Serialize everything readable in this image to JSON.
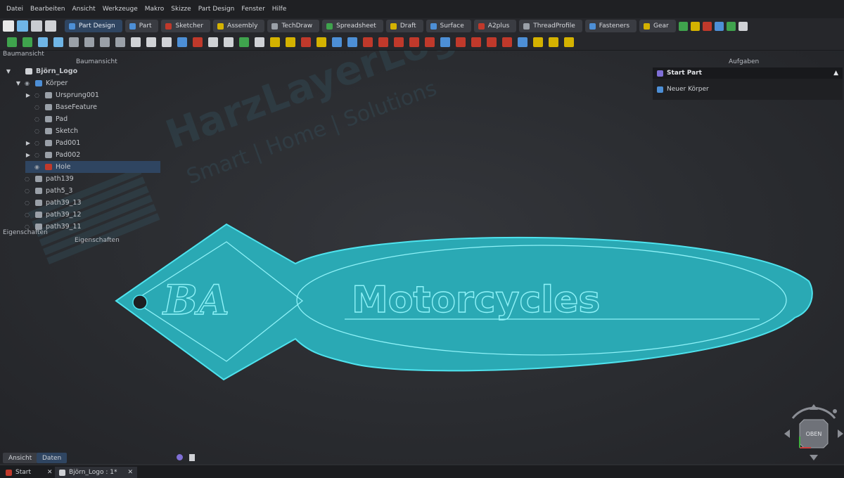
{
  "menu": [
    "Datei",
    "Bearbeiten",
    "Ansicht",
    "Werkzeuge",
    "Makro",
    "Skizze",
    "Part Design",
    "Fenster",
    "Hilfe"
  ],
  "workbenches": [
    {
      "label": "Part Design",
      "color": "#4d8fd6",
      "active": true
    },
    {
      "label": "Part",
      "color": "#4d8fd6"
    },
    {
      "label": "Sketcher",
      "color": "#c0392b"
    },
    {
      "label": "Assembly",
      "color": "#d4b200"
    },
    {
      "label": "TechDraw",
      "color": "#9aa0a8"
    },
    {
      "label": "Spreadsheet",
      "color": "#3fa34d"
    },
    {
      "label": "Draft",
      "color": "#d4b200"
    },
    {
      "label": "Surface",
      "color": "#4d8fd6"
    },
    {
      "label": "A2plus",
      "color": "#c0392b"
    },
    {
      "label": "ThreadProfile",
      "color": "#9aa0a8"
    },
    {
      "label": "Fasteners",
      "color": "#4d8fd6"
    },
    {
      "label": "Gear",
      "color": "#d4b200"
    }
  ],
  "panels": {
    "tree_header_left": "Baumansicht",
    "tree_header": "Baumansicht",
    "props_header_left": "Eigenschaften",
    "props_header": "Eigenschaften",
    "tasks_header": "Aufgaben"
  },
  "tree": [
    {
      "label": "Björn_Logo",
      "level": 0,
      "arrow": "▼",
      "bold": true
    },
    {
      "label": "Körper",
      "level": 1,
      "arrow": "▼"
    },
    {
      "label": "Ursprung001",
      "level": 2,
      "arrow": "▶"
    },
    {
      "label": "BaseFeature",
      "level": 2,
      "arrow": ""
    },
    {
      "label": "Pad",
      "level": 2,
      "arrow": ""
    },
    {
      "label": "Sketch",
      "level": 2,
      "arrow": ""
    },
    {
      "label": "Pad001",
      "level": 2,
      "arrow": "▶"
    },
    {
      "label": "Pad002",
      "level": 2,
      "arrow": "▶"
    },
    {
      "label": "Hole",
      "level": 2,
      "arrow": "",
      "selected": true
    },
    {
      "label": "path139",
      "level": 1,
      "arrow": ""
    },
    {
      "label": "path5_3",
      "level": 1,
      "arrow": ""
    },
    {
      "label": "path39_13",
      "level": 1,
      "arrow": ""
    },
    {
      "label": "path39_12",
      "level": 1,
      "arrow": ""
    },
    {
      "label": "path39_11",
      "level": 1,
      "arrow": ""
    }
  ],
  "tasks": {
    "title": "Start Part",
    "item": "Neuer Körper"
  },
  "watermark": {
    "title": "HarzLayerLogic",
    "subtitle": "Smart | Home | Solutions"
  },
  "model": {
    "left_text": "BA",
    "right_text": "Motorcycles",
    "color": "#36c4cf"
  },
  "navcube": {
    "face": "OBEN"
  },
  "bottom_tabs": [
    "Ansicht",
    "Daten"
  ],
  "doc_tabs": [
    {
      "label": "Start"
    },
    {
      "label": "Björn_Logo : 1*",
      "active": true
    }
  ]
}
